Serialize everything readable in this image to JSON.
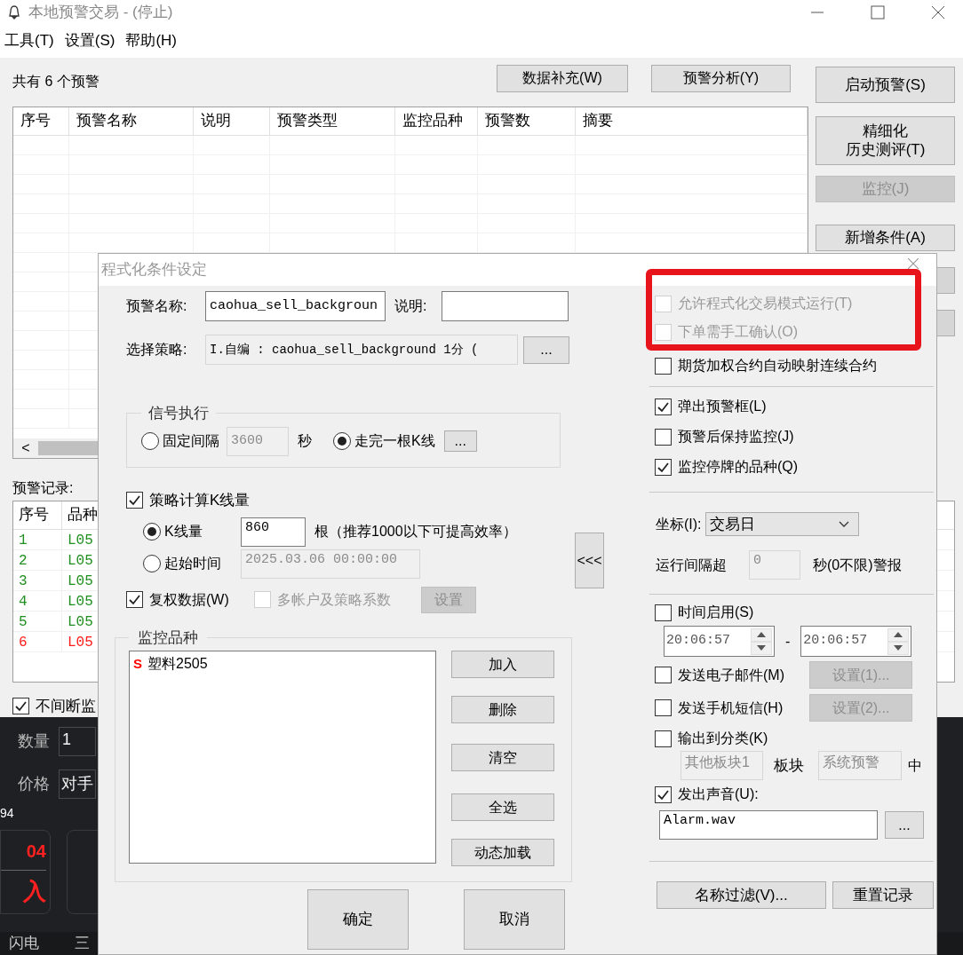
{
  "window": {
    "title": "本地预警交易 - (停止)"
  },
  "menu": [
    "工具(T)",
    "设置(S)",
    "帮助(H)"
  ],
  "alert_count": "共有 6 个预警",
  "top_buttons": [
    "数据补充(W)",
    "预警分析(Y)"
  ],
  "side_buttons": [
    {
      "label": "启动预警(S)",
      "disabled": false
    },
    {
      "label_lines": [
        "精细化",
        "历史测评(T)"
      ],
      "disabled": false
    },
    {
      "label": "监控(J)",
      "disabled": true
    },
    {
      "label": "新增条件(A)",
      "disabled": false
    }
  ],
  "alert_table": {
    "columns": [
      "序号",
      "预警名称",
      "说明",
      "预警类型",
      "监控品种",
      "预警数",
      "摘要"
    ],
    "scroll_left": "<"
  },
  "records": {
    "label": "预警记录:",
    "columns": [
      "序号",
      "品种"
    ],
    "rows": [
      {
        "cells": [
          "1",
          "L05"
        ],
        "color": "#1f8f1f"
      },
      {
        "cells": [
          "2",
          "L05"
        ],
        "color": "#1f8f1f"
      },
      {
        "cells": [
          "3",
          "L05"
        ],
        "color": "#1f8f1f"
      },
      {
        "cells": [
          "4",
          "L05"
        ],
        "color": "#1f8f1f"
      },
      {
        "cells": [
          "5",
          "L05"
        ],
        "color": "#1f8f1f"
      },
      {
        "cells": [
          "6",
          "L05"
        ],
        "color": "#ff1a1a"
      }
    ]
  },
  "continuous_monitor": {
    "label": "不间断监",
    "checked": true
  },
  "trade_panel": {
    "quantity_label": "数量",
    "quantity": "1",
    "price_label": "价格",
    "price": "对手",
    "code": "94",
    "price_value": "04",
    "side": "入",
    "tabs": [
      "闪电",
      "三"
    ]
  },
  "dialog": {
    "title": "程式化条件设定",
    "name_label": "预警名称:",
    "name_value": "caohua_sell_backgroun",
    "desc_label": "说明:",
    "strategy_label": "选择策略:",
    "strategy_value": "I.自编 : caohua_sell_background 1分 (",
    "strategy_button": "...",
    "signal": {
      "title": "信号执行",
      "interval_label": "固定间隔",
      "interval_selected": false,
      "interval_value": "3600",
      "interval_unit": "秒",
      "bar_label": "走完一根K线",
      "bar_selected": true,
      "bar_button": "..."
    },
    "kline": {
      "label": "策略计算K线量",
      "checked": true,
      "count_label": "K线量",
      "count_selected": true,
      "count_value": "860",
      "count_note": "根（推荐1000以下可提高效率）",
      "start_label": "起始时间",
      "start_selected": false,
      "start_value": "2025.03.06 00:00:00"
    },
    "adjusted": {
      "label": "复权数据(W)",
      "checked": true
    },
    "multi_account": {
      "label": "多帐户及策略系数",
      "checked": false,
      "disabled": true
    },
    "settings_button": "设置",
    "collapse_button": "<<<",
    "monitor": {
      "title": "监控品种",
      "items": [
        {
          "prefix": "S",
          "name": "塑料2505"
        }
      ],
      "buttons": [
        "加入",
        "删除",
        "清空",
        "全选",
        "动态加载"
      ]
    },
    "ok_button": "确定",
    "cancel_button": "取消",
    "options": [
      {
        "label": "允许程式化交易模式运行(T)",
        "checked": false,
        "disabled": true
      },
      {
        "label": "下单需手工确认(O)",
        "checked": false,
        "disabled": true
      },
      {
        "label": "期货加权合约自动映射连续合约",
        "checked": false,
        "disabled": false
      }
    ],
    "alert_options": [
      {
        "label": "弹出预警框(L)",
        "checked": true
      },
      {
        "label": "预警后保持监控(J)",
        "checked": false
      },
      {
        "label": "监控停牌的品种(Q)",
        "checked": true
      }
    ],
    "axis_label": "坐标(I):",
    "axis_value": "交易日",
    "interval_label": "运行间隔超",
    "interval_value": "0",
    "interval_unit": "秒(0不限)警报",
    "time_enable": {
      "label": "时间启用(S)",
      "checked": false
    },
    "time_from": "20:06:57",
    "time_sep": "-",
    "time_to": "20:06:57",
    "notify": [
      {
        "label": "发送电子邮件(M)",
        "checked": false,
        "button": "设置(1)..."
      },
      {
        "label": "发送手机短信(H)",
        "checked": false,
        "button": "设置(2)..."
      }
    ],
    "output": {
      "label": "输出到分类(K)",
      "checked": false,
      "block": "其他板块1",
      "block_label": "板块",
      "category": "系统预警",
      "suffix": "中"
    },
    "sound": {
      "label": "发出声音(U):",
      "checked": true,
      "file": "Alarm.wav",
      "browse": "..."
    },
    "filter_button": "名称过滤(V)...",
    "reset_button": "重置记录"
  }
}
